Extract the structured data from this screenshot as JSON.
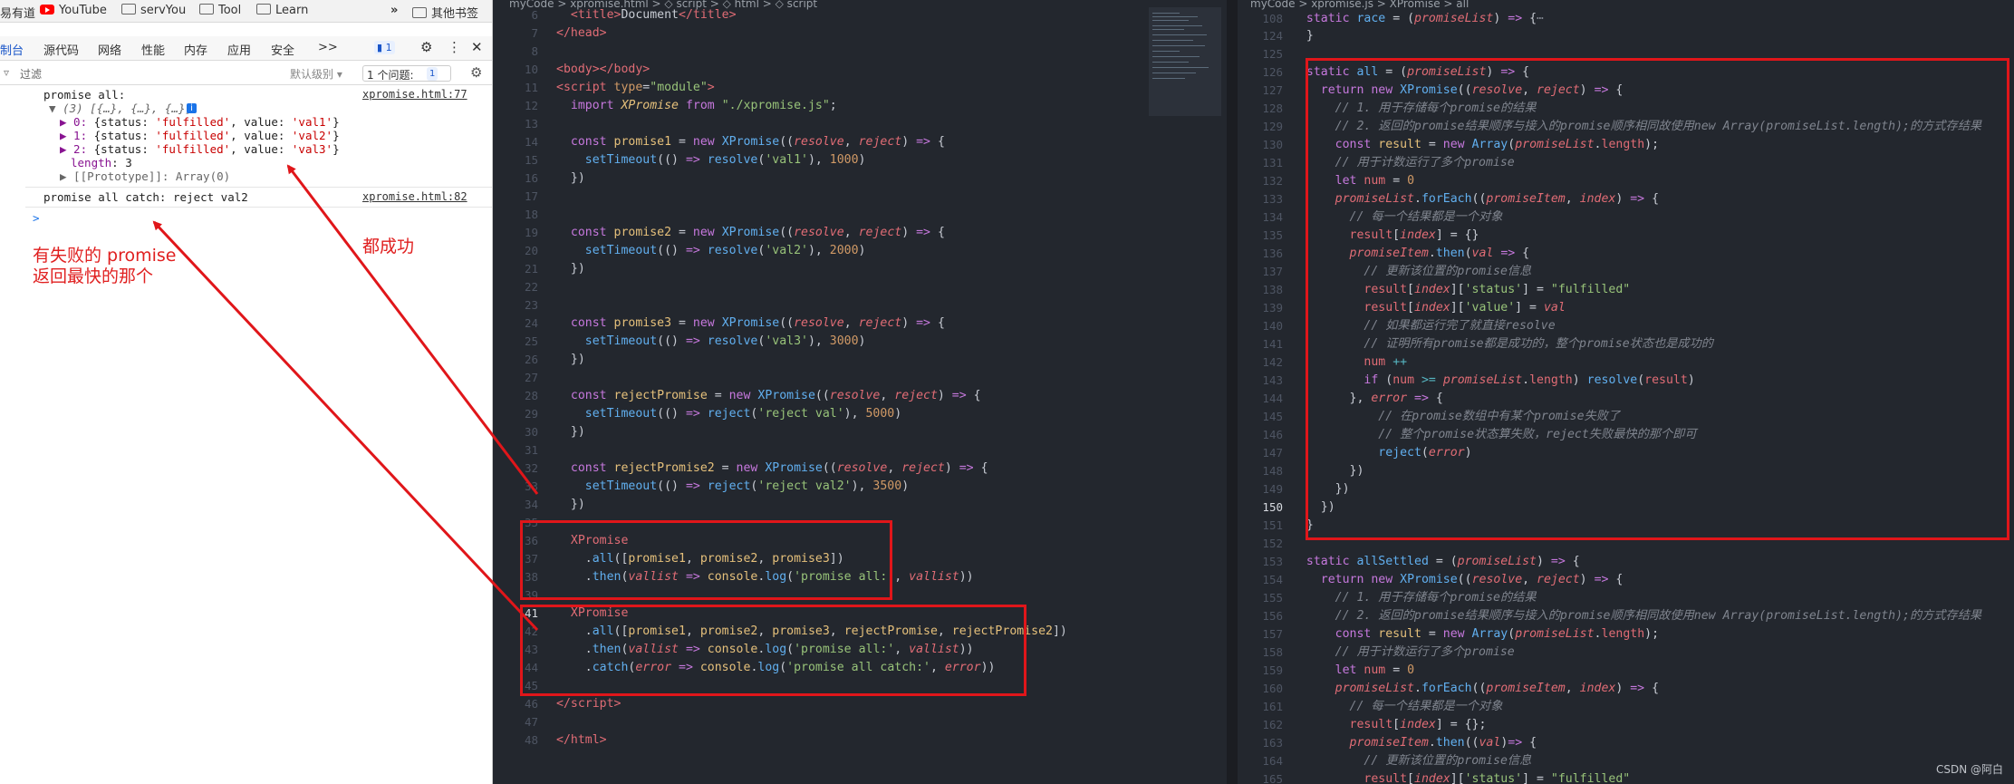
{
  "bookmarks": {
    "items": [
      {
        "label": "易有道",
        "icon": "none"
      },
      {
        "label": "YouTube",
        "icon": "youtube-icon"
      },
      {
        "label": "servYou",
        "icon": "folder-icon"
      },
      {
        "label": "Tool",
        "icon": "folder-icon"
      },
      {
        "label": "Learn",
        "icon": "folder-icon"
      }
    ],
    "more": "»",
    "other": "其他书签"
  },
  "devtools": {
    "tabs": [
      "制台",
      "源代码",
      "网络",
      "性能",
      "内存",
      "应用",
      "安全",
      ">>"
    ],
    "issues_badge": "1",
    "filter_placeholder": "过滤",
    "level": "默认级别 ▾",
    "issues_label": "1 个问题:",
    "issues_count": "1"
  },
  "console": {
    "line1": "promise all:",
    "line1_src": "xpromise.html:77",
    "summary": "▼ (3) [{…}, {…}, {…}]",
    "items": [
      {
        "idx": "▶ 0:",
        "pre": " {status: ",
        "status": "'fulfilled'",
        "mid": ", value: ",
        "value": "'val1'",
        "post": "}"
      },
      {
        "idx": "▶ 1:",
        "pre": " {status: ",
        "status": "'fulfilled'",
        "mid": ", value: ",
        "value": "'val2'",
        "post": "}"
      },
      {
        "idx": "▶ 2:",
        "pre": " {status: ",
        "status": "'fulfilled'",
        "mid": ", value: ",
        "value": "'val3'",
        "post": "}"
      }
    ],
    "length_key": "length",
    "length_val": ": 3",
    "proto": "▶ [[Prototype]]: Array(0)",
    "line2": "promise all catch: reject val2",
    "line2_src": "xpromise.html:82",
    "prompt": ">"
  },
  "annotations": {
    "left_line1": "有失败的 promise",
    "left_line2": "返回最快的那个",
    "right": "都成功"
  },
  "editor_left": {
    "breadcrumb": "myCode  >  xpromise.html  >  ◇ script  >  ◇ html  >  ◇ script"
  },
  "editor_right": {
    "breadcrumb": "myCode  >  xpromise.js  >  XPromise  >  all"
  },
  "watermark": "CSDN @阿白"
}
